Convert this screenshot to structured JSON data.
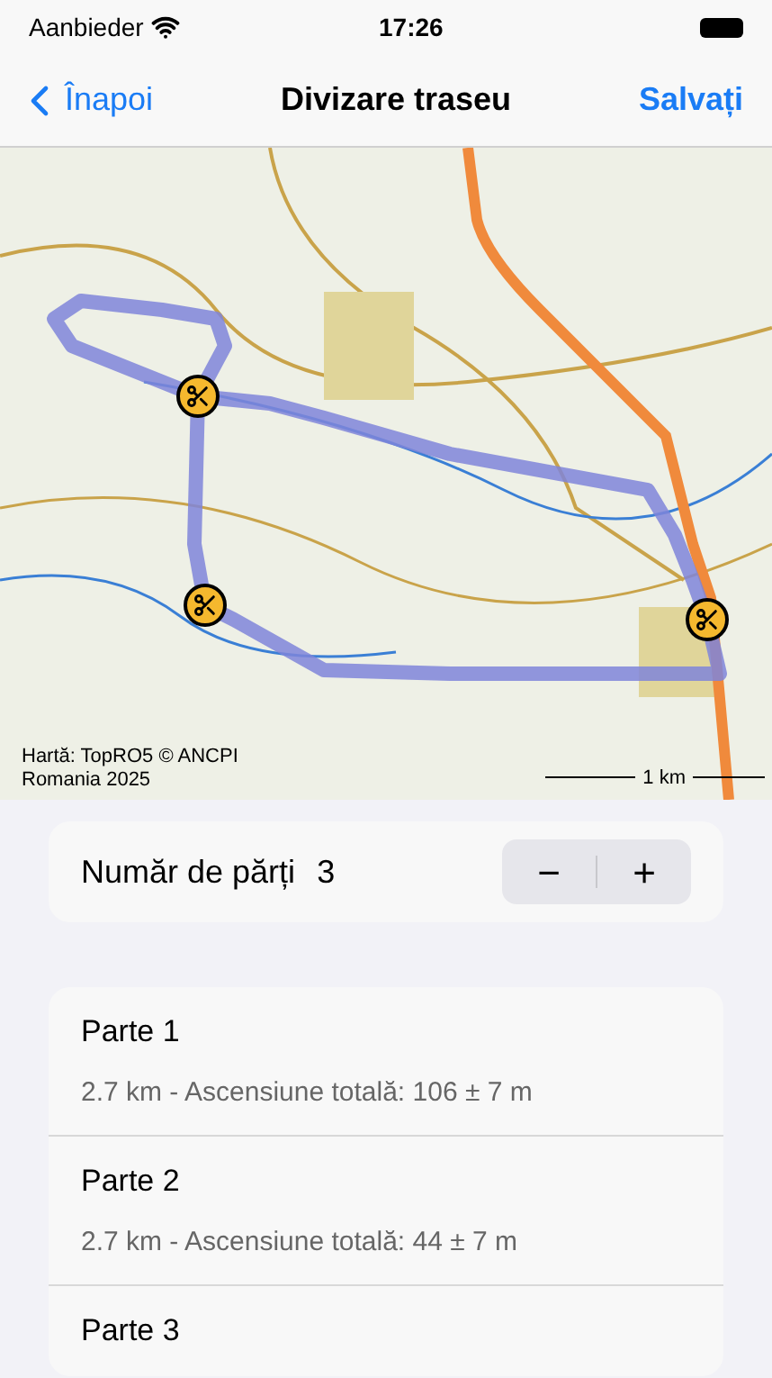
{
  "status_bar": {
    "carrier": "Aanbieder",
    "time": "17:26"
  },
  "nav": {
    "back": "Înapoi",
    "title": "Divizare traseu",
    "action": "Salvați"
  },
  "map": {
    "attribution": "Hartă: TopRO5 © ANCPI\nRomania 2025",
    "scale": "1 km"
  },
  "parts_count": {
    "label": "Număr de părți",
    "value": "3",
    "minus": "−",
    "plus": "+"
  },
  "parts": [
    {
      "title": "Parte 1",
      "detail": "2.7 km - Ascensiune totală: 106 ± 7 m"
    },
    {
      "title": "Parte 2",
      "detail": "2.7 km - Ascensiune totală: 44 ± 7 m"
    },
    {
      "title": "Parte 3"
    }
  ]
}
